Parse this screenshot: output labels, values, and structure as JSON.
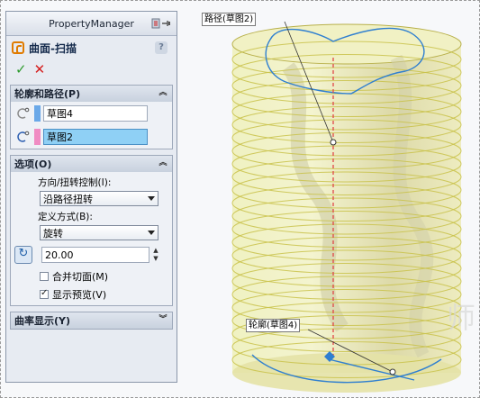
{
  "property_manager": {
    "title": "PropertyManager",
    "feature_title": "曲面-扫描",
    "help": "?",
    "ok": "✓",
    "cancel": "✕"
  },
  "profile_path": {
    "header": "轮廓和路径(P)",
    "profile": "草图4",
    "path": "草图2",
    "profile_color": "#6aa8e8",
    "path_color": "#f08cc3"
  },
  "options": {
    "header": "选项(O)",
    "orientation_label": "方向/扭转控制(I):",
    "orientation_value": "沿路径扭转",
    "define_label": "定义方式(B):",
    "define_value": "旋转",
    "twist_value": "20.00",
    "merge_label": "合并切面(M)",
    "preview_label": "显示预览(V)"
  },
  "curvature": {
    "header": "曲率显示(Y)"
  },
  "viewport": {
    "callout_path": "路径(草图2)",
    "callout_profile": "轮廓(草图4)",
    "surface_color": "#ecec9a",
    "ring_color": "#c9c24a",
    "watermark": "师"
  }
}
